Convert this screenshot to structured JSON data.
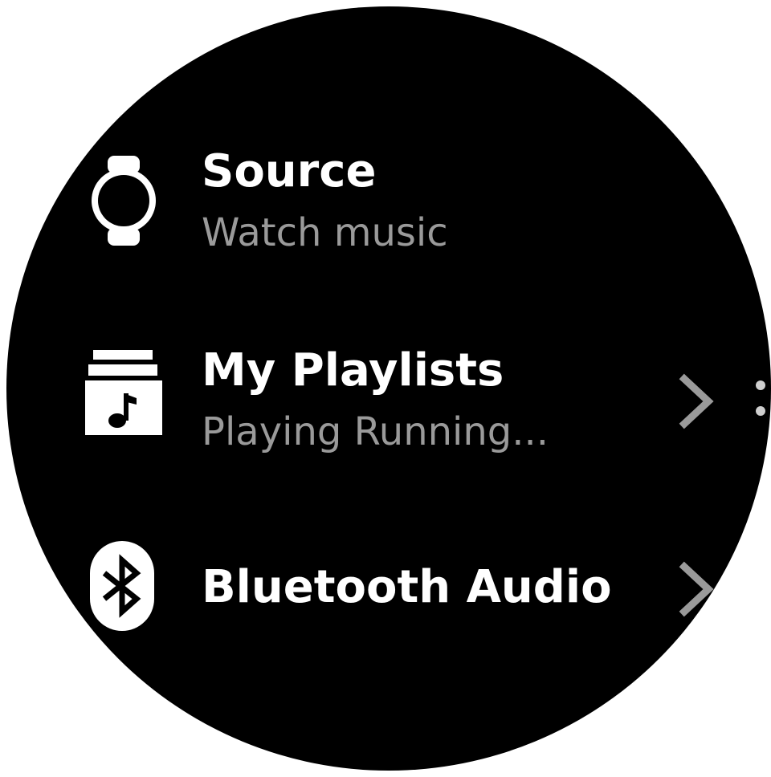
{
  "menu": {
    "items": [
      {
        "icon": "watch-icon",
        "title": "Source",
        "subtitle": "Watch music",
        "has_chevron": false
      },
      {
        "icon": "playlist-icon",
        "title": "My Playlists",
        "subtitle": "Playing Running...",
        "has_chevron": true
      },
      {
        "icon": "bluetooth-icon",
        "title": "Bluetooth Audio",
        "subtitle": "",
        "has_chevron": true
      }
    ]
  },
  "colors": {
    "background": "#000000",
    "title_text": "#ffffff",
    "subtitle_text": "#9a9a9a",
    "chevron": "#9a9a9a"
  }
}
